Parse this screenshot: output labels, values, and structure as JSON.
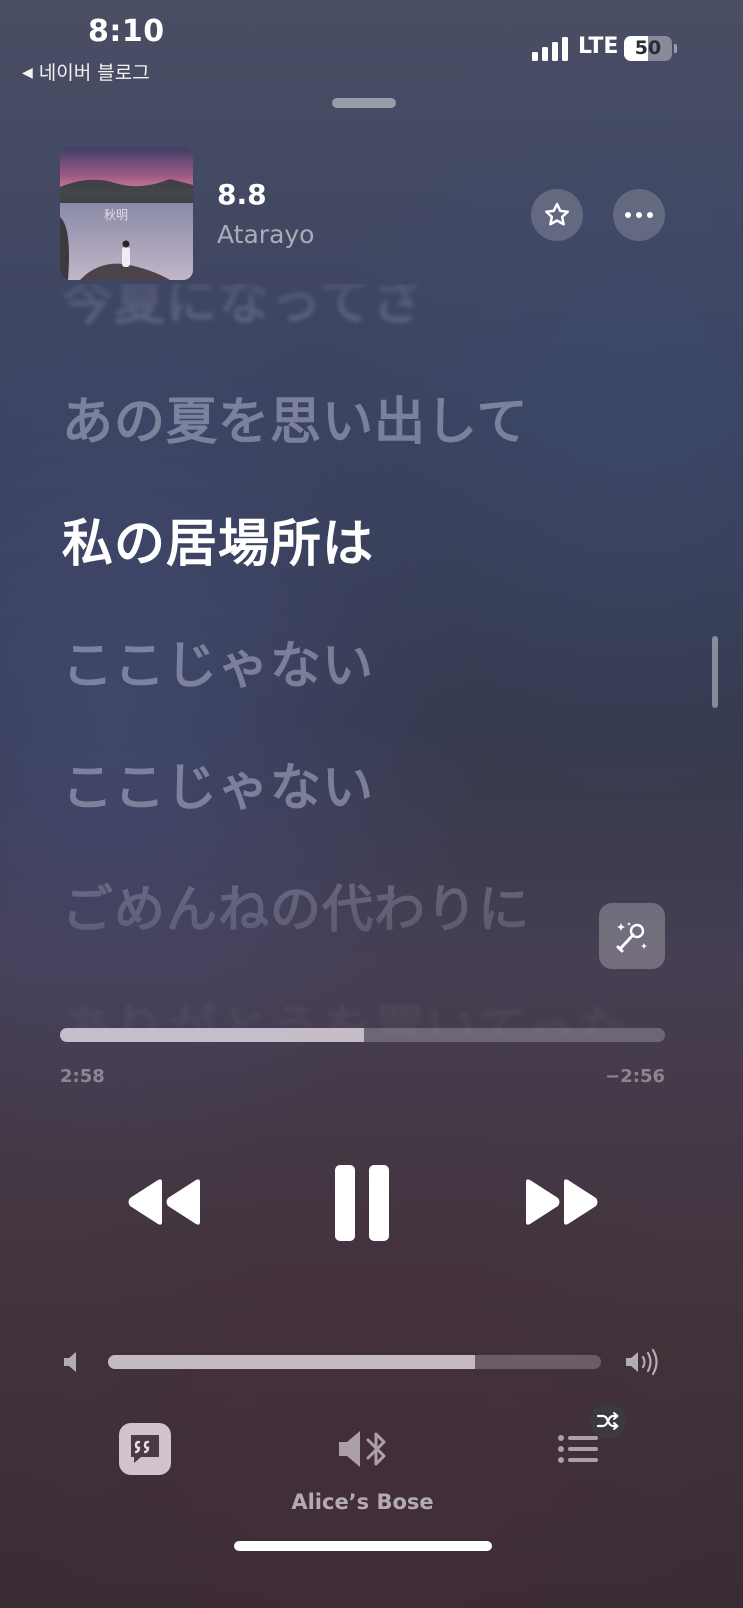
{
  "status_bar": {
    "time": "8:10",
    "back_label": "네이버 블로그",
    "network": "LTE",
    "battery": "50"
  },
  "now_playing": {
    "title": "8.8",
    "artist": "Atarayo",
    "icons": {
      "favorite": "star-outline-icon",
      "more": "ellipsis-icon"
    }
  },
  "lyrics": {
    "lines": [
      {
        "text": "今夏になってさ",
        "state": "past-faded"
      },
      {
        "text": "あの夏を思い出して",
        "state": "upcoming"
      },
      {
        "text": "私の居場所は",
        "state": "current"
      },
      {
        "text": "ここじゃない",
        "state": "upcoming"
      },
      {
        "text": "ここじゃない",
        "state": "upcoming"
      },
      {
        "text": "ごめんねの代わりに",
        "state": "upcoming"
      },
      {
        "text": "ありがとうを置いてった",
        "state": "upcoming-faded"
      }
    ],
    "sing_icon": "microphone-sparkle-icon"
  },
  "playback": {
    "elapsed": "2:58",
    "remaining": "−2:56",
    "progress": 0.503,
    "state": "playing"
  },
  "volume": {
    "level": 0.745
  },
  "bottom_bar": {
    "output_device": "Alice’s Bose",
    "icons": {
      "lyrics": "lyrics-quote-icon",
      "output": "speaker-bluetooth-icon",
      "queue": "list-icon",
      "shuffle": "shuffle-icon"
    }
  },
  "colors": {
    "accent": "#ffffff",
    "dim_text": "#c8cde1"
  }
}
